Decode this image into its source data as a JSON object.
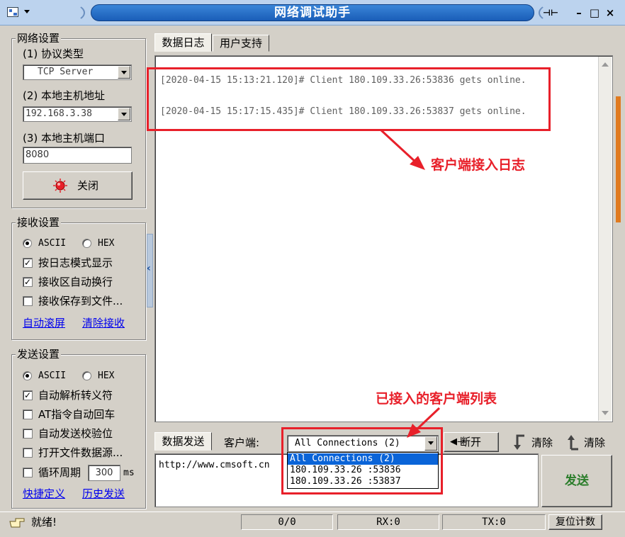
{
  "window": {
    "title": "网络调试助手",
    "controls": {
      "pin": "⊣⊢",
      "minimize": "–",
      "maximize": "□",
      "close": "×"
    }
  },
  "network": {
    "legend": "网络设置",
    "protocol_label": "(1) 协议类型",
    "protocol_value": "TCP Server",
    "host_label": "(2) 本地主机地址",
    "host_value": "192.168.3.38",
    "port_label": "(3) 本地主机端口",
    "port_value": "8080",
    "toggle_button": "关闭",
    "status_color": "#e8202a"
  },
  "receive": {
    "legend": "接收设置",
    "ascii": "ASCII",
    "hex": "HEX",
    "options": [
      {
        "label": "按日志模式显示",
        "checked": true
      },
      {
        "label": "接收区自动换行",
        "checked": true
      },
      {
        "label": "接收保存到文件...",
        "checked": false
      }
    ],
    "auto_scroll": "自动滚屏",
    "clear_receive": "清除接收"
  },
  "send": {
    "legend": "发送设置",
    "ascii": "ASCII",
    "hex": "HEX",
    "options": [
      {
        "label": "自动解析转义符",
        "checked": true
      },
      {
        "label": "AT指令自动回车",
        "checked": false
      },
      {
        "label": "自动发送校验位",
        "checked": false
      },
      {
        "label": "打开文件数据源...",
        "checked": false
      }
    ],
    "cycle_label": "循环周期",
    "cycle_value": "300",
    "cycle_unit": "ms",
    "shortcut": "快捷定义",
    "history": "历史发送"
  },
  "tabs": {
    "log": "数据日志",
    "support": "用户支持"
  },
  "log": {
    "lines": [
      "[2020-04-15 15:13:21.120]# Client 180.109.33.26:53836 gets online.",
      "[2020-04-15 15:17:15.435]# Client 180.109.33.26:53837 gets online."
    ]
  },
  "annotations": {
    "log_note": "客户端接入日志",
    "list_note": "已接入的客户端列表",
    "color": "#e8202a"
  },
  "send_bar": {
    "tab": "数据发送",
    "client_label": "客户端:",
    "connection_value": "All Connections (2)",
    "connection_options": [
      "All Connections (2)",
      "180.109.33.26 :53836",
      "180.109.33.26 :53837"
    ],
    "disconnect": "断开",
    "clear1": "清除",
    "clear2": "清除",
    "input_value": "http://www.cmsoft.cn",
    "send_button": "发送"
  },
  "status": {
    "ready": "就绪!",
    "count": "0/0",
    "rx": "RX:0",
    "tx": "TX:0",
    "reset": "复位计数"
  }
}
